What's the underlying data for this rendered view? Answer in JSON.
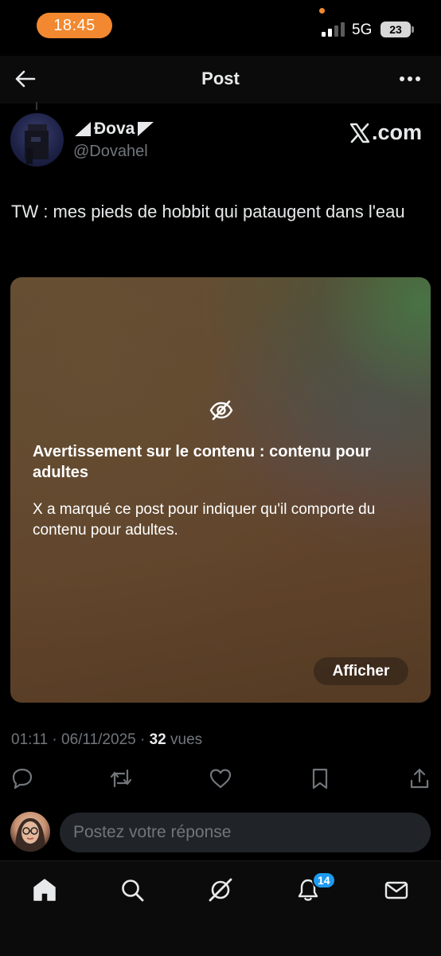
{
  "status_bar": {
    "time": "18:45",
    "network": "5G",
    "battery": "23",
    "accent_color": "#f2882f"
  },
  "header": {
    "title": "Post",
    "back_icon": "arrow-left-icon",
    "more_icon": "more-horizontal-icon"
  },
  "post": {
    "author": {
      "display_name": "Đova",
      "handle": "@Dovahel"
    },
    "source_label": ".com",
    "text": "TW : mes pieds de hobbit qui pataugent dans l'eau",
    "media_warning": {
      "icon": "eye-off-icon",
      "title": "Avertissement sur le contenu : contenu pour adultes",
      "body": "X a marqué ce post pour indiquer qu'il comporte du contenu pour adultes.",
      "show_label": "Afficher"
    },
    "meta": {
      "timestamp": "01:11 · 06/11/2025 · ",
      "views_count": "32",
      "views_label": " vues"
    }
  },
  "actions": [
    "reply-icon",
    "repost-icon",
    "like-icon",
    "bookmark-icon",
    "share-icon"
  ],
  "reply": {
    "placeholder": "Postez votre réponse"
  },
  "tab_bar": {
    "items": [
      "home-icon",
      "search-icon",
      "grok-icon",
      "notifications-icon",
      "messages-icon"
    ],
    "notifications_badge": "14",
    "badge_color": "#1d9bf0"
  }
}
